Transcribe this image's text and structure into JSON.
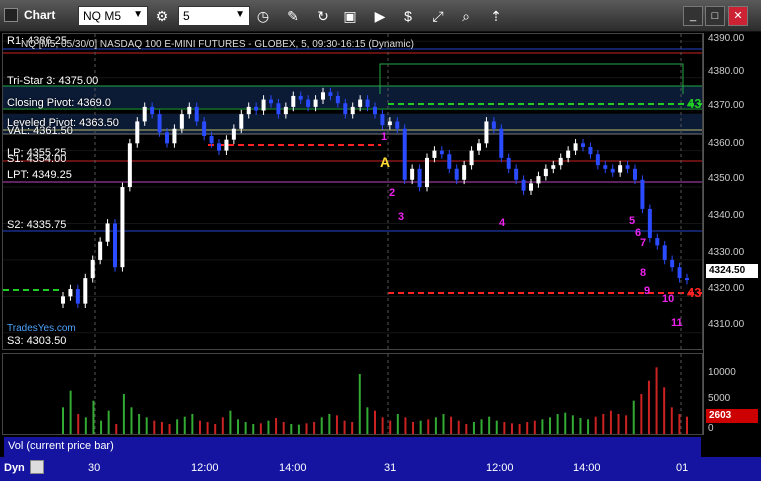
{
  "window": {
    "title": "Chart",
    "symbol": "NQ M5",
    "interval": "5"
  },
  "chart_header": "NQ [M5, 05/30/0] NASDAQ 100 E-MINI FUTURES - GLOBEX, 5, 09:30-16:15 (Dynamic)",
  "y_axis": {
    "ticks": [
      "4390.00",
      "4380.00",
      "4370.00",
      "4360.00",
      "4350.00",
      "4340.00",
      "4330.00",
      "4320.00",
      "4310.00"
    ],
    "current_price": "4324.50",
    "current_price_color": "#ffffff",
    "volume_ticks": [
      "10000",
      "5000",
      "0"
    ],
    "current_volume": "2603",
    "current_volume_color": "#cc0000"
  },
  "levels": [
    {
      "label": "R1: 4386.25"
    },
    {
      "label": "Tri-Star 3: 4375.00"
    },
    {
      "label": "Closing Pivot: 4369.0"
    },
    {
      "label": "Leveled Pivot: 4363.50"
    },
    {
      "label": "VAL: 4361.50"
    },
    {
      "label": "LP: 4355.25"
    },
    {
      "label": "S1: 4354.00"
    },
    {
      "label": "LPT: 4349.25"
    },
    {
      "label": "S2: 4335.75"
    },
    {
      "label": "S3: 4303.50"
    }
  ],
  "annotations": {
    "left_marker": "A",
    "right_count_a": "43",
    "right_count_b": "43",
    "blog_text": "TradesYes.com"
  },
  "counts_magenta": [
    "1",
    "2",
    "3",
    "4",
    "5",
    "6",
    "7",
    "8",
    "9",
    "10",
    "11"
  ],
  "volume_panel_label": "Vol (current price bar)",
  "x_axis": {
    "ticks": [
      "30",
      "12:00",
      "14:00",
      "31",
      "12:00",
      "14:00",
      "01"
    ],
    "dyn_label": "Dyn"
  },
  "chart_data": {
    "type": "candlestick",
    "x": [
      "30",
      "12:00",
      "14:00",
      "31",
      "12:00",
      "14:00",
      "01"
    ],
    "ylim": [
      4305,
      4392
    ],
    "close_path": [
      4320,
      4322,
      4318,
      4325,
      4330,
      4335,
      4340,
      4328,
      4350,
      4362,
      4368,
      4372,
      4370,
      4365,
      4362,
      4366,
      4370,
      4372,
      4368,
      4364,
      4362,
      4360,
      4363,
      4366,
      4370,
      4372,
      4371,
      4374,
      4373,
      4370,
      4372,
      4375,
      4374,
      4372,
      4374,
      4376,
      4375,
      4373,
      4370,
      4372,
      4374,
      4372,
      4370,
      4367,
      4368,
      4366,
      4352,
      4355,
      4350,
      4358,
      4360,
      4359,
      4355,
      4352,
      4356,
      4360,
      4362,
      4368,
      4366,
      4358,
      4355,
      4352,
      4349,
      4351,
      4353,
      4355,
      4356,
      4358,
      4360,
      4362,
      4361,
      4359,
      4356,
      4355,
      4354,
      4356,
      4355,
      4352,
      4344,
      4336,
      4334,
      4330,
      4328,
      4325,
      4324.5
    ],
    "volume": [
      4000,
      6500,
      3000,
      2500,
      5000,
      2000,
      3500,
      1500,
      6000,
      4000,
      3000,
      2500,
      2000,
      1800,
      1500,
      2200,
      2600,
      3000,
      2000,
      1800,
      1500,
      2500,
      3500,
      2200,
      1800,
      1500,
      1600,
      2000,
      2400,
      1800,
      1500,
      1400,
      1600,
      1800,
      2500,
      3000,
      2800,
      2000,
      1800,
      9000,
      4000,
      3500,
      2500,
      2000,
      3000,
      2500,
      1800,
      2000,
      2200,
      2500,
      3000,
      2600,
      2000,
      1500,
      1800,
      2200,
      2600,
      2000,
      1800,
      1600,
      1500,
      1800,
      2000,
      2200,
      2500,
      3000,
      3200,
      2800,
      2400,
      2200,
      2600,
      3000,
      3500,
      3000,
      2800,
      5000,
      6000,
      8000,
      10000,
      7000,
      4000,
      3000,
      2603
    ]
  },
  "colors": {
    "up_candle": "#ffffff",
    "down_candle": "#2a4bff",
    "r1_line": "#cc2222",
    "tristar_line": "#22aa44",
    "pivot_line": "#22aa44",
    "s_line": "#cc2222",
    "s2_line": "#2244cc",
    "magenta": "#ee22ee",
    "green_marks": "#22aa44",
    "axis_blue": "#1414a0"
  }
}
